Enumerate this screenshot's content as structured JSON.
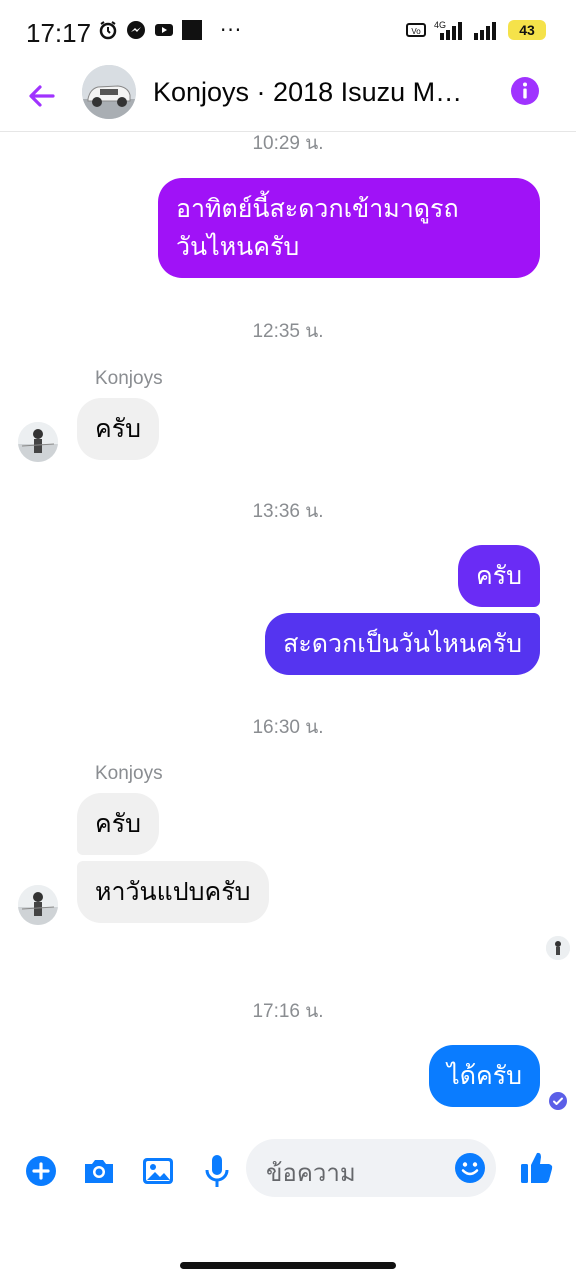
{
  "status_bar": {
    "time": "17:17",
    "dots": "···",
    "battery": "43",
    "network": "4G",
    "icons": [
      "alarm-icon",
      "messenger-icon",
      "youtube-icon",
      "square-icon"
    ]
  },
  "header": {
    "title": "Konjoys · 2018 Isuzu M…",
    "accent": "#a033ff"
  },
  "messages": [
    {
      "type": "timestamp",
      "text": "10:29 น."
    },
    {
      "type": "outgoing",
      "lines": [
        "อาทิตย์นี้สะดวกเข้ามาดูรถ",
        "วันไหนครับ"
      ],
      "color": "#a012f7"
    },
    {
      "type": "timestamp",
      "text": "12:35 น."
    },
    {
      "type": "sender",
      "text": "Konjoys"
    },
    {
      "type": "incoming",
      "text": "ครับ"
    },
    {
      "type": "timestamp",
      "text": "13:36 น."
    },
    {
      "type": "outgoing",
      "text": "ครับ",
      "color": "#6a2cf5"
    },
    {
      "type": "outgoing",
      "text": "สะดวกเป็นวันไหนครับ",
      "color": "#5534f0"
    },
    {
      "type": "timestamp",
      "text": "16:30 น."
    },
    {
      "type": "sender",
      "text": "Konjoys"
    },
    {
      "type": "incoming",
      "text": "ครับ"
    },
    {
      "type": "incoming",
      "text": "หาวันแปบครับ"
    },
    {
      "type": "timestamp",
      "text": "17:16 น."
    },
    {
      "type": "outgoing",
      "text": "ได้ครับ",
      "color": "#0a7cff"
    }
  ],
  "composer": {
    "placeholder": "ข้อความ",
    "accent": "#0a7cff"
  }
}
